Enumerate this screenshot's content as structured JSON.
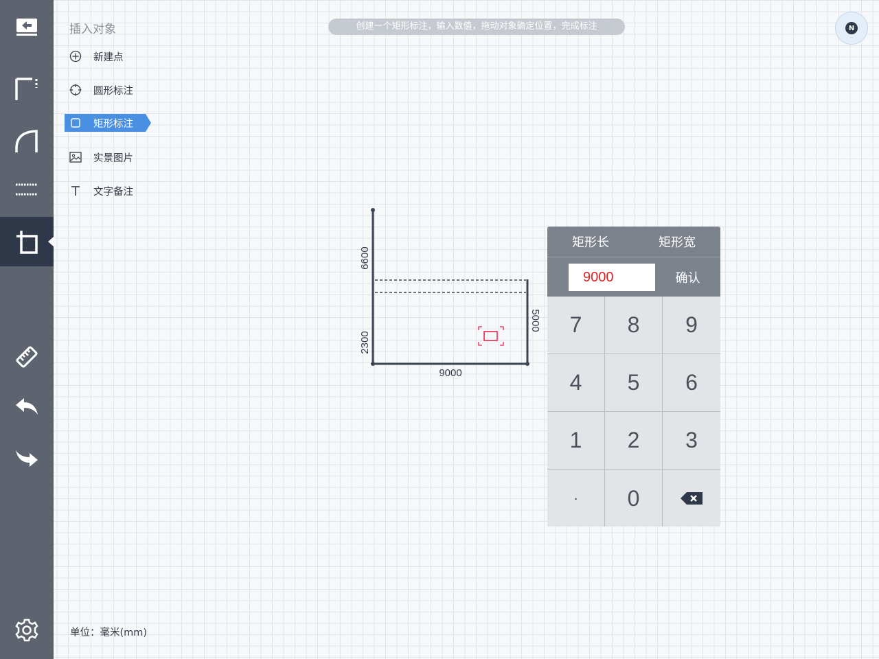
{
  "sidebar": {
    "items": [
      {
        "name": "exit-icon"
      },
      {
        "name": "wall-icon"
      },
      {
        "name": "arc-icon"
      },
      {
        "name": "dashed-line-icon"
      },
      {
        "name": "insert-object-icon",
        "active": true
      },
      {
        "name": "ruler-icon"
      },
      {
        "name": "undo-icon"
      },
      {
        "name": "redo-icon"
      },
      {
        "name": "settings-icon"
      }
    ]
  },
  "menu": {
    "title": "插入对象",
    "items": [
      {
        "label": "新建点",
        "icon": "plus-circle-icon"
      },
      {
        "label": "圆形标注",
        "icon": "crosshair-icon"
      },
      {
        "label": "矩形标注",
        "icon": "square-icon",
        "selected": true
      },
      {
        "label": "实景图片",
        "icon": "image-icon"
      },
      {
        "label": "文字备注",
        "icon": "text-icon"
      }
    ]
  },
  "hint": "创建一个矩形标注，输入数值，拖动对象确定位置，完成标注",
  "compass": {
    "label": "N"
  },
  "drawing": {
    "dims": {
      "left_upper": "6600",
      "left_lower": "2300",
      "right": "5000",
      "bottom": "9000"
    }
  },
  "keypad": {
    "tab_length": "矩形长",
    "tab_width": "矩形宽",
    "value": "9000",
    "confirm": "确认",
    "keys": [
      "7",
      "8",
      "9",
      "4",
      "5",
      "6",
      "1",
      "2",
      "3",
      "·",
      "0"
    ]
  },
  "footer": {
    "unit": "单位：毫米(mm)"
  },
  "colors": {
    "sidebar_bg": "#5d6470",
    "sidebar_active": "#2f3848",
    "accent_blue": "#4a90e2",
    "input_red": "#e02020",
    "marker_red": "#e8264e"
  }
}
